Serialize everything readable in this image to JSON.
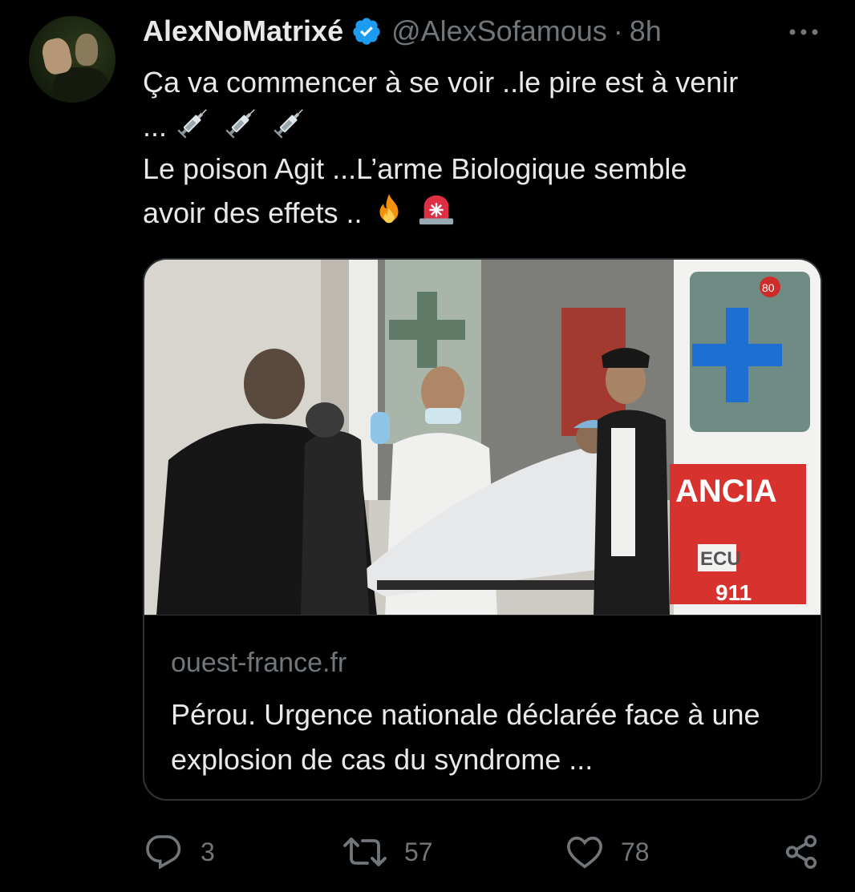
{
  "author": {
    "display_name": "AlexNoMatrixé",
    "handle": "@AlexSofamous",
    "separator": "·",
    "time": "8h",
    "verified": true
  },
  "tweet": {
    "line1": "Ça va commencer à se voir ..le pire est à venir",
    "line2_prefix": "...",
    "line3": "Le poison Agit ...L’arme Biologique semble",
    "line4": "avoir des effets .."
  },
  "card": {
    "domain": "ouest-france.fr",
    "title": "Pérou. Urgence nationale déclarée face à une explosion de cas du syndrome ...",
    "image_labels": {
      "ancia": "ANCIA",
      "ecu": "ECU",
      "number": "911",
      "unit": "80"
    }
  },
  "actions": {
    "reply_count": "3",
    "retweet_count": "57",
    "like_count": "78"
  },
  "colors": {
    "background": "#000000",
    "text": "#e7e9ea",
    "muted": "#71767b",
    "verified_blue": "#1d9bf0",
    "border": "#2f3336"
  }
}
